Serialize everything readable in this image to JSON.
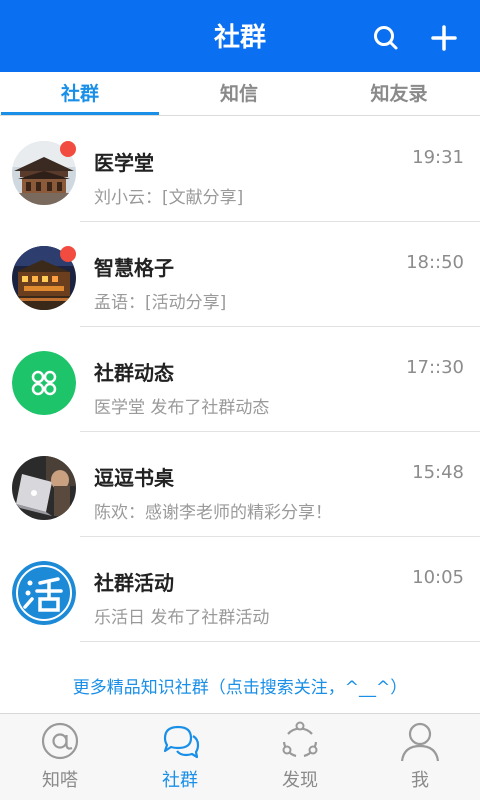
{
  "header": {
    "title": "社群",
    "search_icon": "search-icon",
    "add_icon": "plus-icon",
    "bg_color": "#0a6ff0"
  },
  "tabs": [
    {
      "label": "社群",
      "active": true
    },
    {
      "label": "知信",
      "active": false
    },
    {
      "label": "知友录",
      "active": false
    }
  ],
  "conversations": [
    {
      "title": "医学堂",
      "time": "19:31",
      "subtitle": "刘小云：[文献分享]",
      "unread": true,
      "avatar": "temple-photo-avatar"
    },
    {
      "title": "智慧格子",
      "time": "18::50",
      "subtitle": "孟语：[活动分享]",
      "unread": true,
      "avatar": "night-building-photo-avatar"
    },
    {
      "title": "社群动态",
      "time": "17::30",
      "subtitle": "医学堂 发布了社群动态",
      "unread": false,
      "avatar": "green-grid-icon-avatar"
    },
    {
      "title": "逗逗书桌",
      "time": "15:48",
      "subtitle": "陈欢：感谢李老师的精彩分享！",
      "unread": false,
      "avatar": "laptop-photo-avatar"
    },
    {
      "title": "社群活动",
      "time": "10:05",
      "subtitle": "乐活日 发布了社群活动",
      "unread": false,
      "avatar": "huo-character-icon-avatar"
    }
  ],
  "more_link": "更多精品知识社群（点击搜索关注，^__^）",
  "bottom_nav": [
    {
      "label": "知嗒",
      "icon": "at-sign-icon",
      "active": false
    },
    {
      "label": "社群",
      "icon": "chat-bubbles-icon",
      "active": true
    },
    {
      "label": "发现",
      "icon": "discover-icon",
      "active": false
    },
    {
      "label": "我",
      "icon": "person-icon",
      "active": false
    }
  ],
  "colors": {
    "accent": "#1a8fe8",
    "unread_dot": "#f24b3f",
    "green_icon": "#1ec46a"
  }
}
